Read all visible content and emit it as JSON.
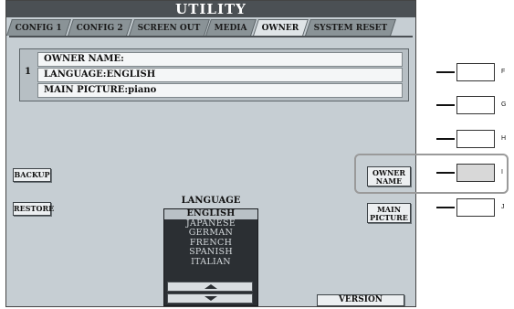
{
  "screen": {
    "title": "UTILITY",
    "tabs": [
      "CONFIG 1",
      "CONFIG 2",
      "SCREEN OUT",
      "MEDIA",
      "OWNER",
      "SYSTEM RESET"
    ],
    "active_tab": "OWNER"
  },
  "owner": {
    "number": "1",
    "name_label": "OWNER NAME:",
    "language_label": "LANGUAGE:ENGLISH",
    "picture_label": "MAIN PICTURE:piano"
  },
  "buttons": {
    "backup": "BACKUP",
    "restore": "RESTORE",
    "owner_name": [
      "OWNER",
      "NAME"
    ],
    "main_picture": [
      "MAIN",
      "PICTURE"
    ],
    "version": "VERSION"
  },
  "language": {
    "label": "LANGUAGE",
    "options": [
      "ENGLISH",
      "JAPANESE",
      "GERMAN",
      "FRENCH",
      "SPANISH",
      "ITALIAN"
    ],
    "selected": "ENGLISH"
  },
  "hardware": {
    "letters": [
      "F",
      "G",
      "H",
      "I",
      "J"
    ],
    "pressed": "I"
  },
  "colors": {
    "screen_bg": "#c6ced3",
    "title_bg": "#4b5054",
    "list_bg": "#2b2f33"
  },
  "icons": {
    "scroll_up": "triangle-up-icon",
    "scroll_down": "triangle-down-icon"
  }
}
